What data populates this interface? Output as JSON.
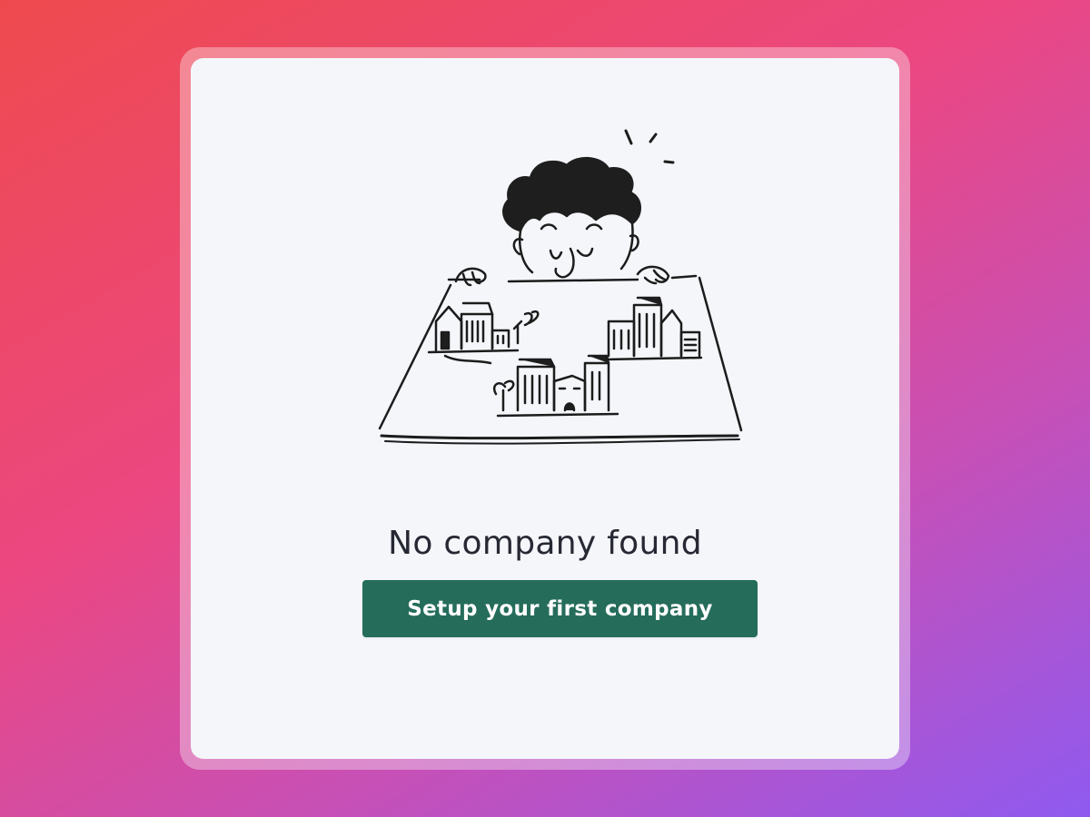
{
  "empty_state": {
    "illustration": "person-looking-at-city-map-illustration",
    "title": "No company found",
    "button_label": "Setup your first company"
  },
  "colors": {
    "button": "#256c5b",
    "card": "#f4f6fa",
    "gradient_start": "#ee4a4e",
    "gradient_end": "#8f5af0"
  }
}
